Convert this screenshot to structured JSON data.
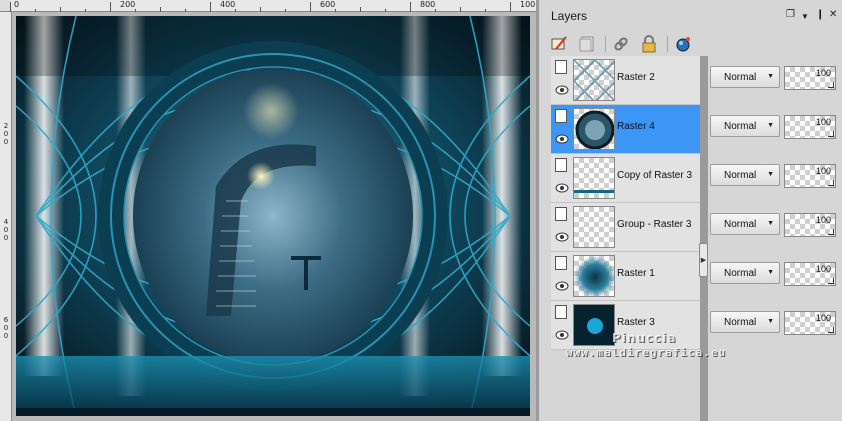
{
  "rulers": {
    "top": [
      "0",
      "200",
      "400",
      "600",
      "800",
      "100"
    ],
    "left": [
      "2",
      "0",
      "0",
      "4",
      "0",
      "0",
      "6",
      "0",
      "0"
    ]
  },
  "panel": {
    "title": "Layers",
    "header_icons": [
      "restore-icon",
      "dropdown-icon",
      "pin-icon",
      "close-icon"
    ],
    "toolbar_icons": [
      "layer-properties-icon",
      "new-layer-icon",
      "link-icon",
      "lock-icon",
      "layer-effect-icon"
    ]
  },
  "layers": [
    {
      "name": "Raster 2",
      "selected": false,
      "thumb": "checker-pattern",
      "blend": "Normal",
      "opacity": "100"
    },
    {
      "name": "Raster 4",
      "selected": true,
      "thumb": "circle-scene",
      "blend": "Normal",
      "opacity": "100"
    },
    {
      "name": "Copy of Raster 3",
      "selected": false,
      "thumb": "checker-stripe",
      "blend": "Normal",
      "opacity": "100"
    },
    {
      "name": "Group - Raster 3",
      "selected": false,
      "thumb": "checker",
      "blend": "Normal",
      "opacity": "100"
    },
    {
      "name": "Raster 1",
      "selected": false,
      "thumb": "teal-blur",
      "blend": "Normal",
      "opacity": "100"
    },
    {
      "name": "Raster 3",
      "selected": false,
      "thumb": "teal-circle",
      "blend": "Normal",
      "opacity": "100"
    }
  ],
  "watermark": {
    "line1": "Pinuccia",
    "line2": "www.maldiregrafica.eu"
  },
  "colors": {
    "selection": "#3d95f5",
    "teal": "#1a8fb0",
    "dark": "#0b2a38"
  }
}
